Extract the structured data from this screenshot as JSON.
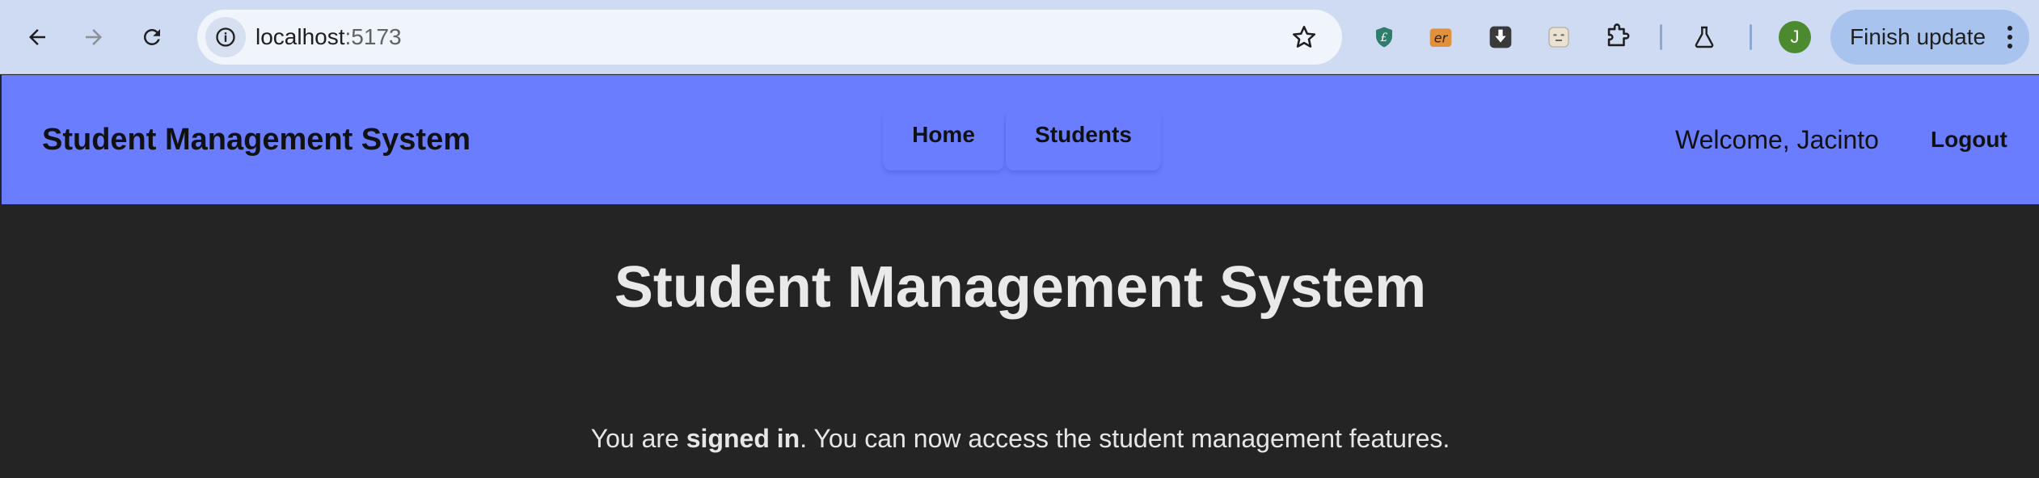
{
  "browser": {
    "url_host": "localhost",
    "url_port": ":5173",
    "update_label": "Finish update",
    "profile_initial": "J",
    "extensions": [
      "shield-extension-icon",
      "er-extension-icon",
      "download-extension-icon",
      "face-extension-icon",
      "puzzle-extensions-icon",
      "labs-flask-icon"
    ]
  },
  "header": {
    "brand": "Student Management System",
    "nav": [
      {
        "label": "Home"
      },
      {
        "label": "Students"
      }
    ],
    "welcome": "Welcome, Jacinto",
    "logout": "Logout"
  },
  "main": {
    "title": "Student Management System",
    "status_prefix": "You are ",
    "status_bold": "signed in",
    "status_suffix": ". You can now access the student management features."
  },
  "colors": {
    "header_bg": "#6a7dff",
    "page_bg": "#242424",
    "chrome_bg": "#cfdbf2"
  }
}
